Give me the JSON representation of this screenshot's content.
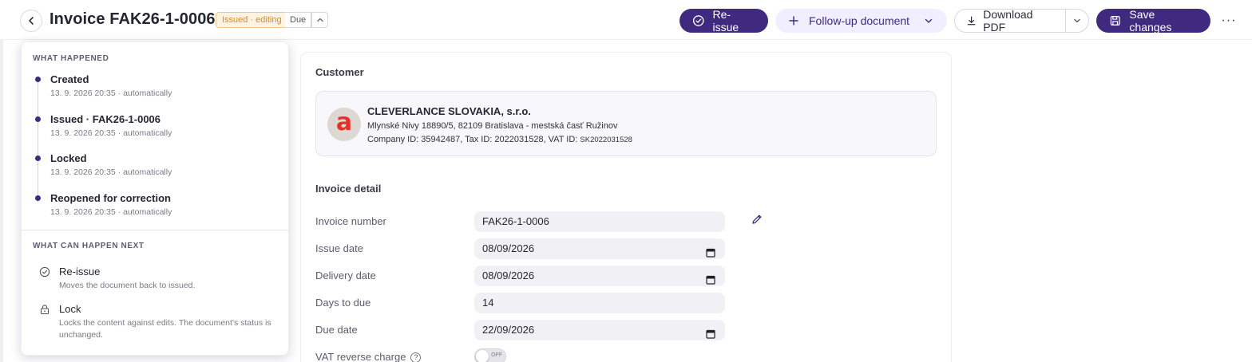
{
  "header": {
    "title": "Invoice FAK26-1-0006",
    "status_badge": "Issued · editing",
    "due_badge": "Due",
    "reissue_label": "Re-issue",
    "followup_label": "Follow-up document",
    "download_label": "Download PDF",
    "save_label": "Save changes",
    "more_label": "···"
  },
  "colors": {
    "primary": "#3f2a80",
    "badge_editing_bg": "#fff3e0",
    "badge_editing_text": "#d88b24"
  },
  "history_popover": {
    "happened_heading": "WHAT HAPPENED",
    "events": [
      {
        "title": "Created",
        "meta": "13. 9. 2026 20:35 · automatically"
      },
      {
        "title": "Issued · FAK26-1-0006",
        "meta": "13. 9. 2026 20:35 · automatically"
      },
      {
        "title": "Locked",
        "meta": "13. 9. 2026 20:35 · automatically"
      },
      {
        "title": "Reopened for correction",
        "meta": "13. 9. 2026 20:35 · automatically"
      }
    ],
    "next_heading": "WHAT CAN HAPPEN NEXT",
    "next_actions": [
      {
        "icon": "check-circle-icon",
        "title": "Re-issue",
        "description": "Moves the document back to issued."
      },
      {
        "icon": "lock-icon",
        "title": "Lock",
        "description": "Locks the content against edits. The document's status is unchanged."
      }
    ]
  },
  "customer": {
    "section_title": "Customer",
    "logo_letter": "a",
    "name": "CLEVERLANCE SLOVAKIA, s.r.o.",
    "address": "Mlynské Nivy 18890/5, 82109 Bratislava - mestská časť Ružinov",
    "ids_prefix": "Company ID: 35942487, Tax ID: 2022031528, VAT ID: ",
    "vat_id": "SK2022031528"
  },
  "invoice_detail": {
    "section_title": "Invoice detail",
    "fields": [
      {
        "label": "Invoice number",
        "value": "FAK26-1-0006"
      },
      {
        "label": "Issue date",
        "value": "08/09/2026"
      },
      {
        "label": "Delivery date",
        "value": "08/09/2026"
      },
      {
        "label": "Days to due",
        "value": "14"
      },
      {
        "label": "Due date",
        "value": "22/09/2026"
      }
    ],
    "reverse_charge_label": "VAT reverse charge",
    "reverse_charge_help": "?",
    "reverse_charge_state": "OFF"
  }
}
